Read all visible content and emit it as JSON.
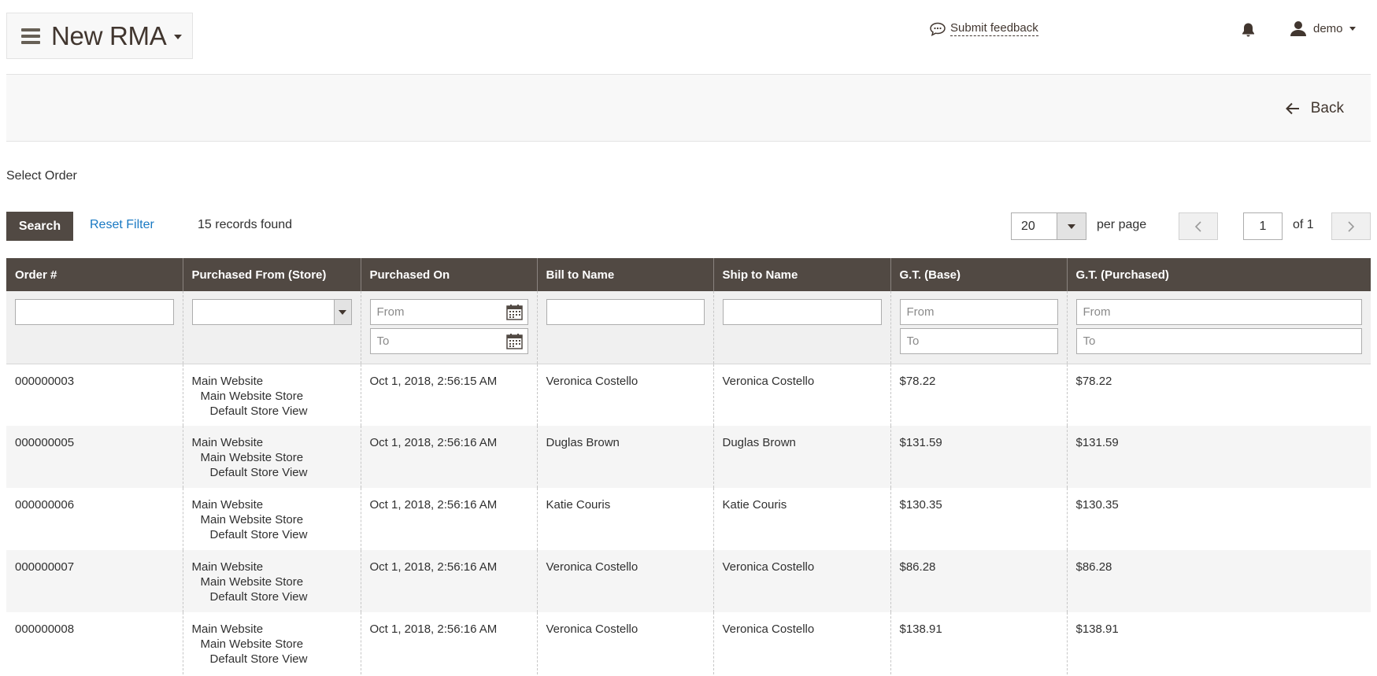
{
  "header": {
    "title": "New RMA",
    "feedback_label": "Submit feedback",
    "user_name": "demo"
  },
  "actions": {
    "back_label": "Back"
  },
  "section": {
    "title": "Select Order"
  },
  "toolbar": {
    "search_label": "Search",
    "reset_label": "Reset Filter",
    "records_found": "15 records found",
    "per_page_value": "20",
    "per_page_label": "per page",
    "page_current": "1",
    "page_total": "of 1"
  },
  "grid": {
    "columns": [
      "Order #",
      "Purchased From (Store)",
      "Purchased On",
      "Bill to Name",
      "Ship to Name",
      "G.T. (Base)",
      "G.T. (Purchased)"
    ],
    "filters": {
      "from_placeholder": "From",
      "to_placeholder": "To"
    },
    "rows": [
      {
        "order": "000000003",
        "store": [
          "Main Website",
          "Main Website Store",
          "Default Store View"
        ],
        "purchased_on": "Oct 1, 2018, 2:56:15 AM",
        "bill_to": "Veronica Costello",
        "ship_to": "Veronica Costello",
        "gt_base": "$78.22",
        "gt_purchased": "$78.22"
      },
      {
        "order": "000000005",
        "store": [
          "Main Website",
          "Main Website Store",
          "Default Store View"
        ],
        "purchased_on": "Oct 1, 2018, 2:56:16 AM",
        "bill_to": "Duglas Brown",
        "ship_to": "Duglas Brown",
        "gt_base": "$131.59",
        "gt_purchased": "$131.59"
      },
      {
        "order": "000000006",
        "store": [
          "Main Website",
          "Main Website Store",
          "Default Store View"
        ],
        "purchased_on": "Oct 1, 2018, 2:56:16 AM",
        "bill_to": "Katie Couris",
        "ship_to": "Katie Couris",
        "gt_base": "$130.35",
        "gt_purchased": "$130.35"
      },
      {
        "order": "000000007",
        "store": [
          "Main Website",
          "Main Website Store",
          "Default Store View"
        ],
        "purchased_on": "Oct 1, 2018, 2:56:16 AM",
        "bill_to": "Veronica Costello",
        "ship_to": "Veronica Costello",
        "gt_base": "$86.28",
        "gt_purchased": "$86.28"
      },
      {
        "order": "000000008",
        "store": [
          "Main Website",
          "Main Website Store",
          "Default Store View"
        ],
        "purchased_on": "Oct 1, 2018, 2:56:16 AM",
        "bill_to": "Veronica Costello",
        "ship_to": "Veronica Costello",
        "gt_base": "$138.91",
        "gt_purchased": "$138.91"
      }
    ]
  }
}
